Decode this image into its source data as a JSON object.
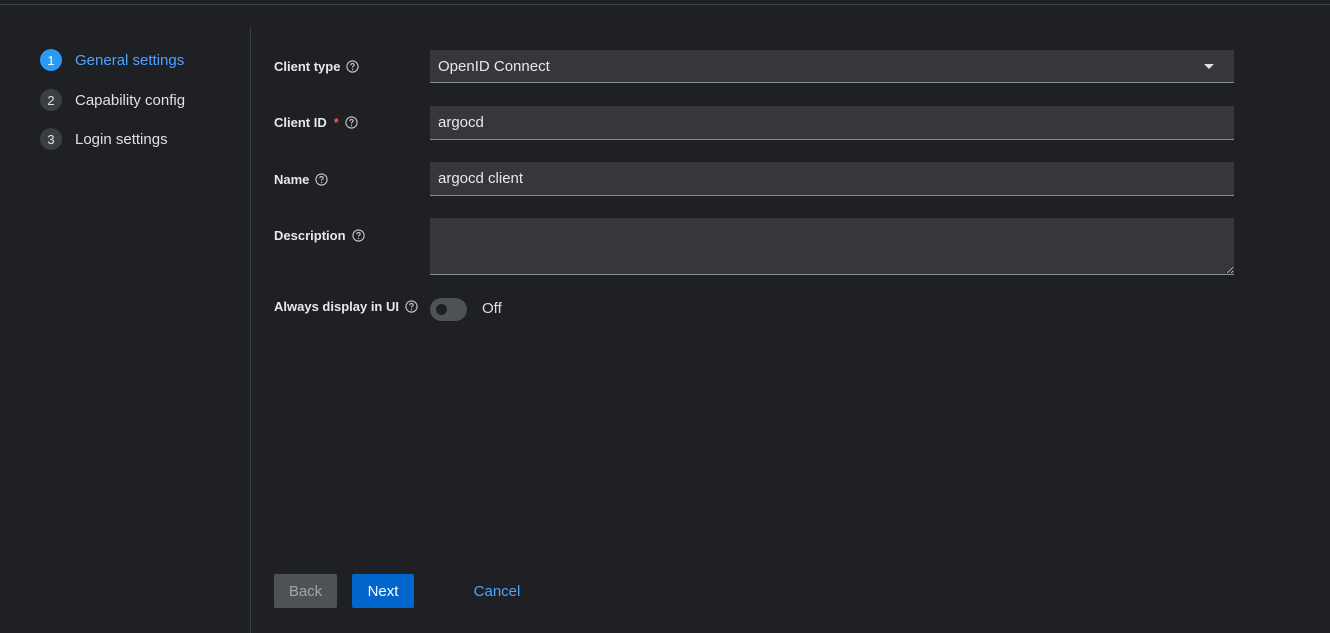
{
  "wizard": {
    "steps": [
      {
        "number": "1",
        "label": "General settings",
        "active": true
      },
      {
        "number": "2",
        "label": "Capability config",
        "active": false
      },
      {
        "number": "3",
        "label": "Login settings",
        "active": false
      }
    ]
  },
  "form": {
    "client_type": {
      "label": "Client type",
      "value": "OpenID Connect"
    },
    "client_id": {
      "label": "Client ID",
      "required_mark": "*",
      "value": "argocd"
    },
    "name": {
      "label": "Name",
      "value": "argocd client"
    },
    "description": {
      "label": "Description",
      "value": ""
    },
    "always_display": {
      "label": "Always display in UI",
      "state": "Off"
    }
  },
  "actions": {
    "back": "Back",
    "next": "Next",
    "cancel": "Cancel"
  },
  "colors": {
    "accent": "#2b9af3",
    "primary_button": "#0066cc",
    "link": "#4da3ff",
    "required": "#f05555",
    "background": "#1f2023"
  }
}
